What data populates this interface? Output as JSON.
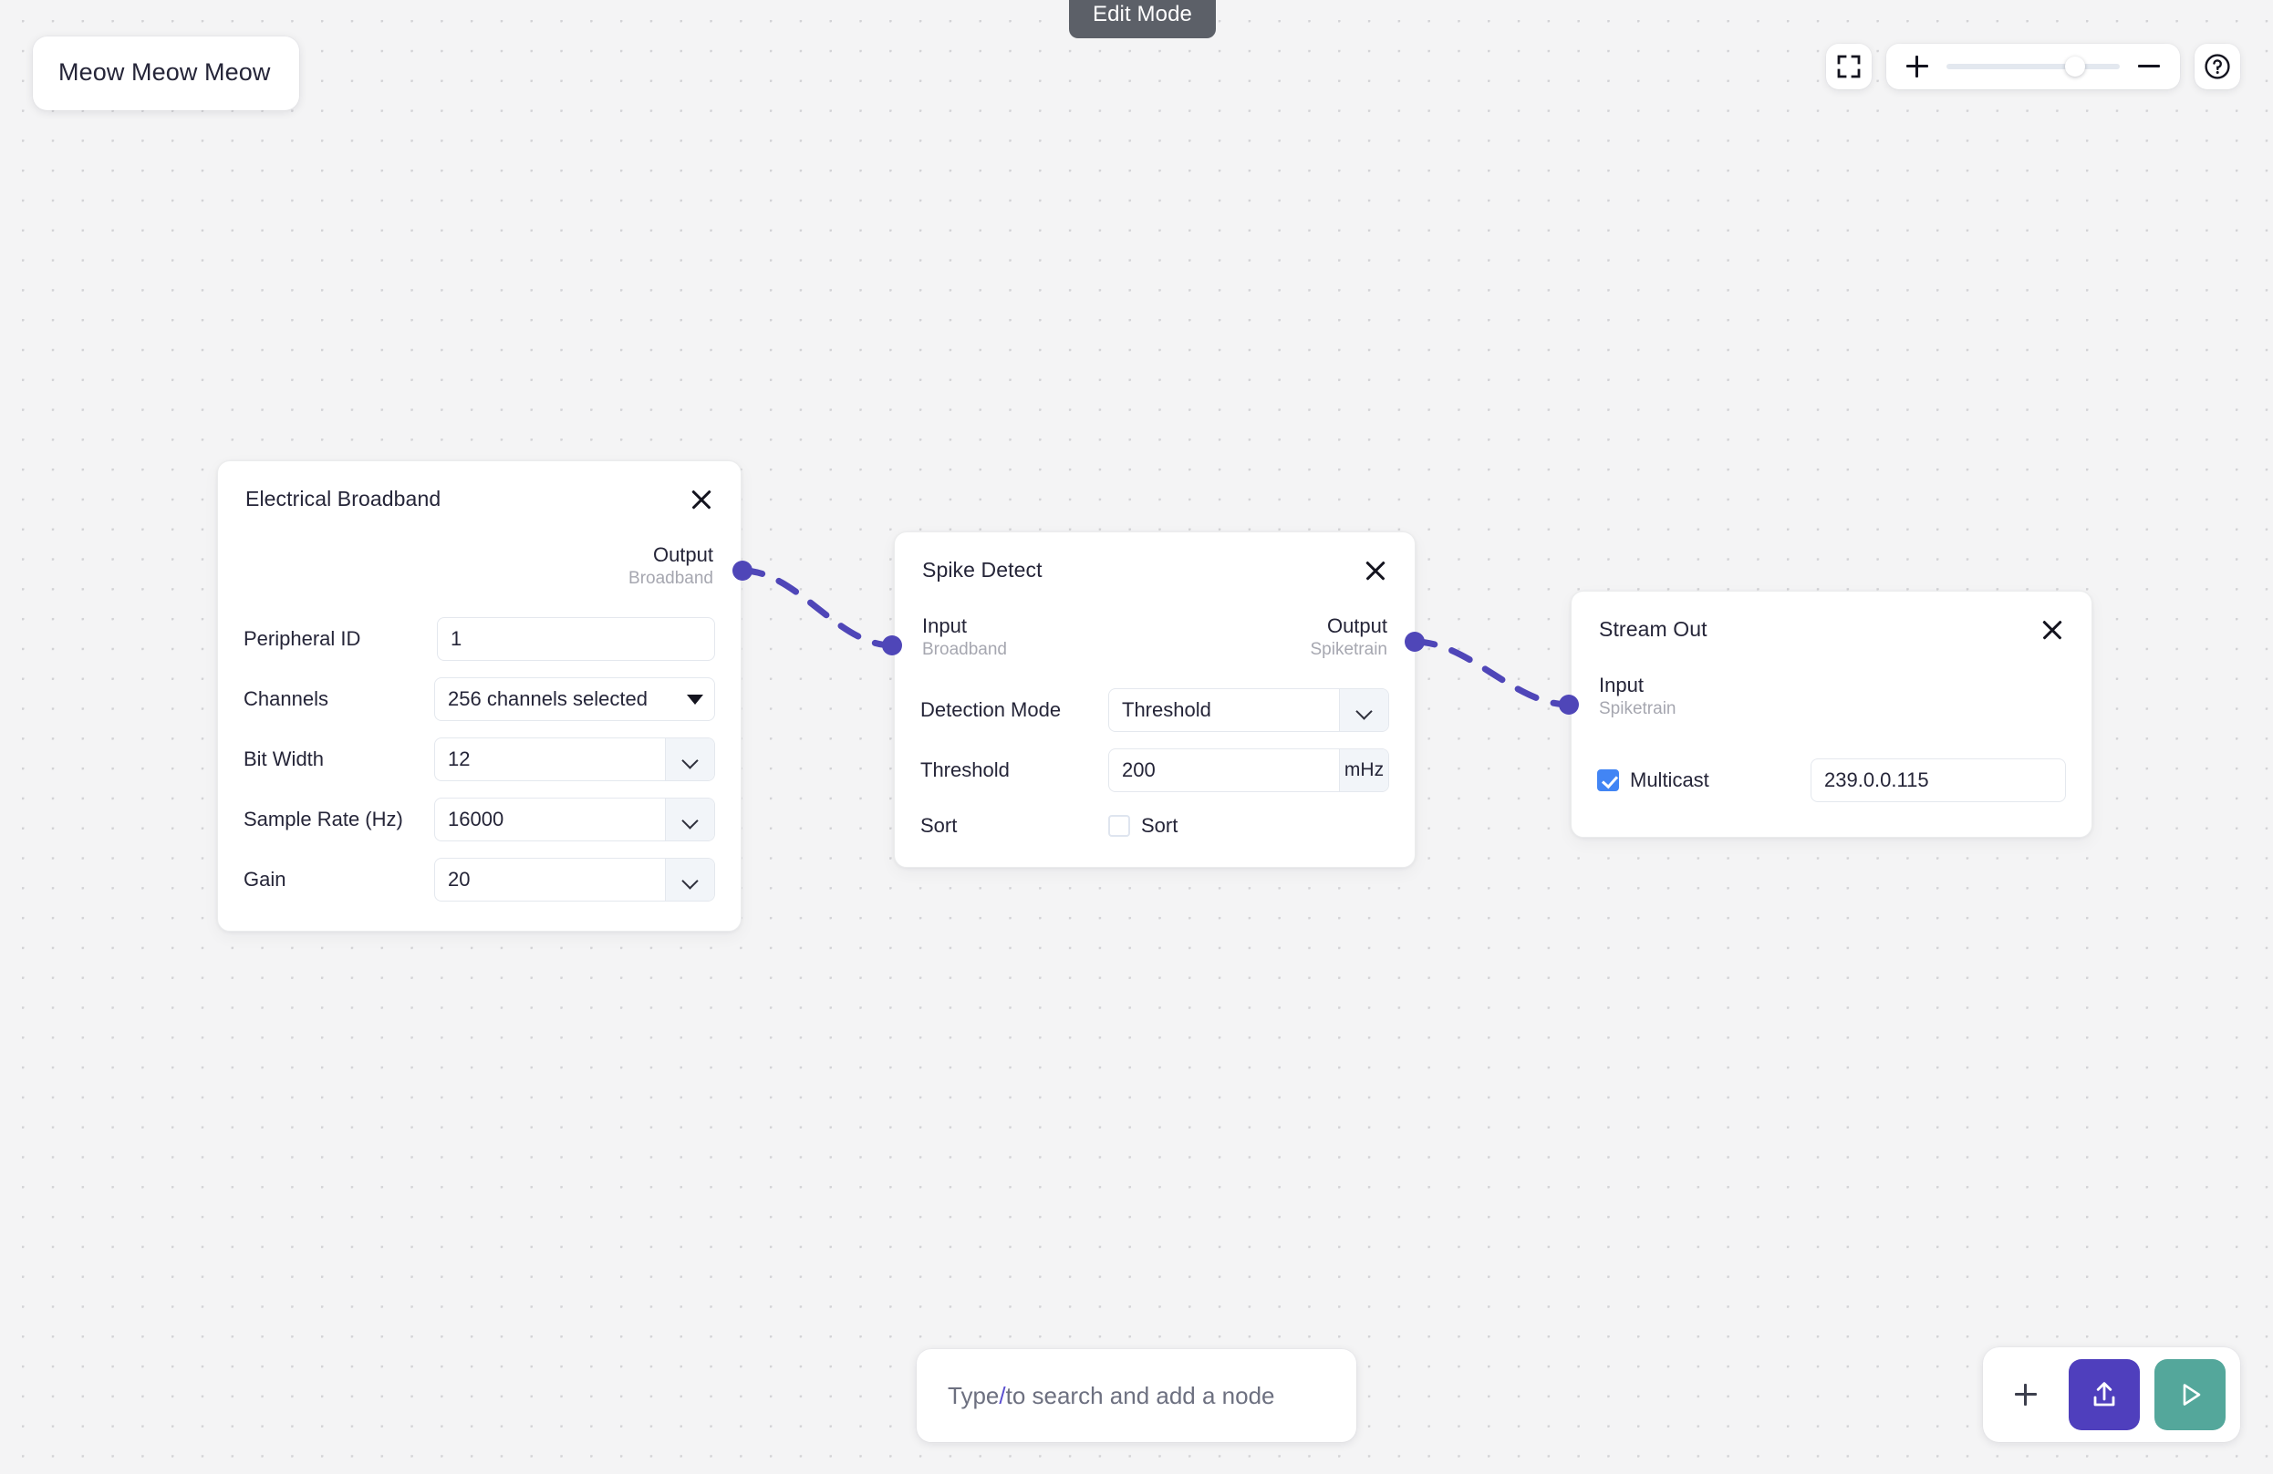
{
  "app": {
    "mode_badge": "Edit Mode",
    "pipeline_title": "Meow Meow Meow",
    "accent_purple": "#4f46b8",
    "accent_upload": "#4f3fbd",
    "accent_run": "#54a79b",
    "checkbox_blue": "#4285f4",
    "canvas_bg": "#f4f4f5"
  },
  "top_controls": {
    "fit_view_icon": "fit-view-icon",
    "zoom_in_icon": "plus-icon",
    "zoom_out_icon": "minus-icon",
    "zoom_value_pct": 74,
    "help_icon": "question-mark-circle-icon",
    "help_label": "?"
  },
  "nodes": [
    {
      "id": "electrical-broadband",
      "title": "Electrical Broadband",
      "close_label": "✕",
      "ports": {
        "output": {
          "name": "Output",
          "type": "Broadband"
        }
      },
      "fields": [
        {
          "label": "Peripheral ID",
          "kind": "text",
          "value": "1"
        },
        {
          "label": "Channels",
          "kind": "select",
          "value": "256 channels selected"
        },
        {
          "label": "Bit Width",
          "kind": "combo",
          "value": "12",
          "side": "chevron-down-icon"
        },
        {
          "label": "Sample Rate (Hz)",
          "kind": "combo",
          "value": "16000",
          "side": "chevron-down-icon"
        },
        {
          "label": "Gain",
          "kind": "combo",
          "value": "20",
          "side": "chevron-down-icon"
        }
      ]
    },
    {
      "id": "spike-detect",
      "title": "Spike Detect",
      "close_label": "✕",
      "ports": {
        "input": {
          "name": "Input",
          "type": "Broadband"
        },
        "output": {
          "name": "Output",
          "type": "Spiketrain"
        }
      },
      "fields": [
        {
          "label": "Detection Mode",
          "kind": "combo",
          "value": "Threshold",
          "side": "chevron-down-icon"
        },
        {
          "label": "Threshold",
          "kind": "combo-unit",
          "value": "200",
          "unit": "mHz"
        },
        {
          "label": "Sort",
          "kind": "checkbox",
          "checked": false,
          "checkbox_label": "Sort"
        }
      ]
    },
    {
      "id": "stream-out",
      "title": "Stream Out",
      "close_label": "✕",
      "ports": {
        "input": {
          "name": "Input",
          "type": "Spiketrain"
        }
      },
      "fields": [
        {
          "label": "",
          "kind": "checkbox-text",
          "checked": true,
          "checkbox_label": "Multicast",
          "value": "239.0.0.115"
        }
      ]
    }
  ],
  "edges": [
    {
      "from": "electrical-broadband.output",
      "to": "spike-detect.input"
    },
    {
      "from": "spike-detect.output",
      "to": "stream-out.input"
    }
  ],
  "search": {
    "prefix": "Type ",
    "slash": "/",
    "suffix": " to search and add a node",
    "placeholder": "Type / to search and add a node"
  },
  "actions": {
    "add_label": "+",
    "add_icon": "plus-icon",
    "upload_icon": "upload-icon",
    "run_icon": "play-icon"
  }
}
